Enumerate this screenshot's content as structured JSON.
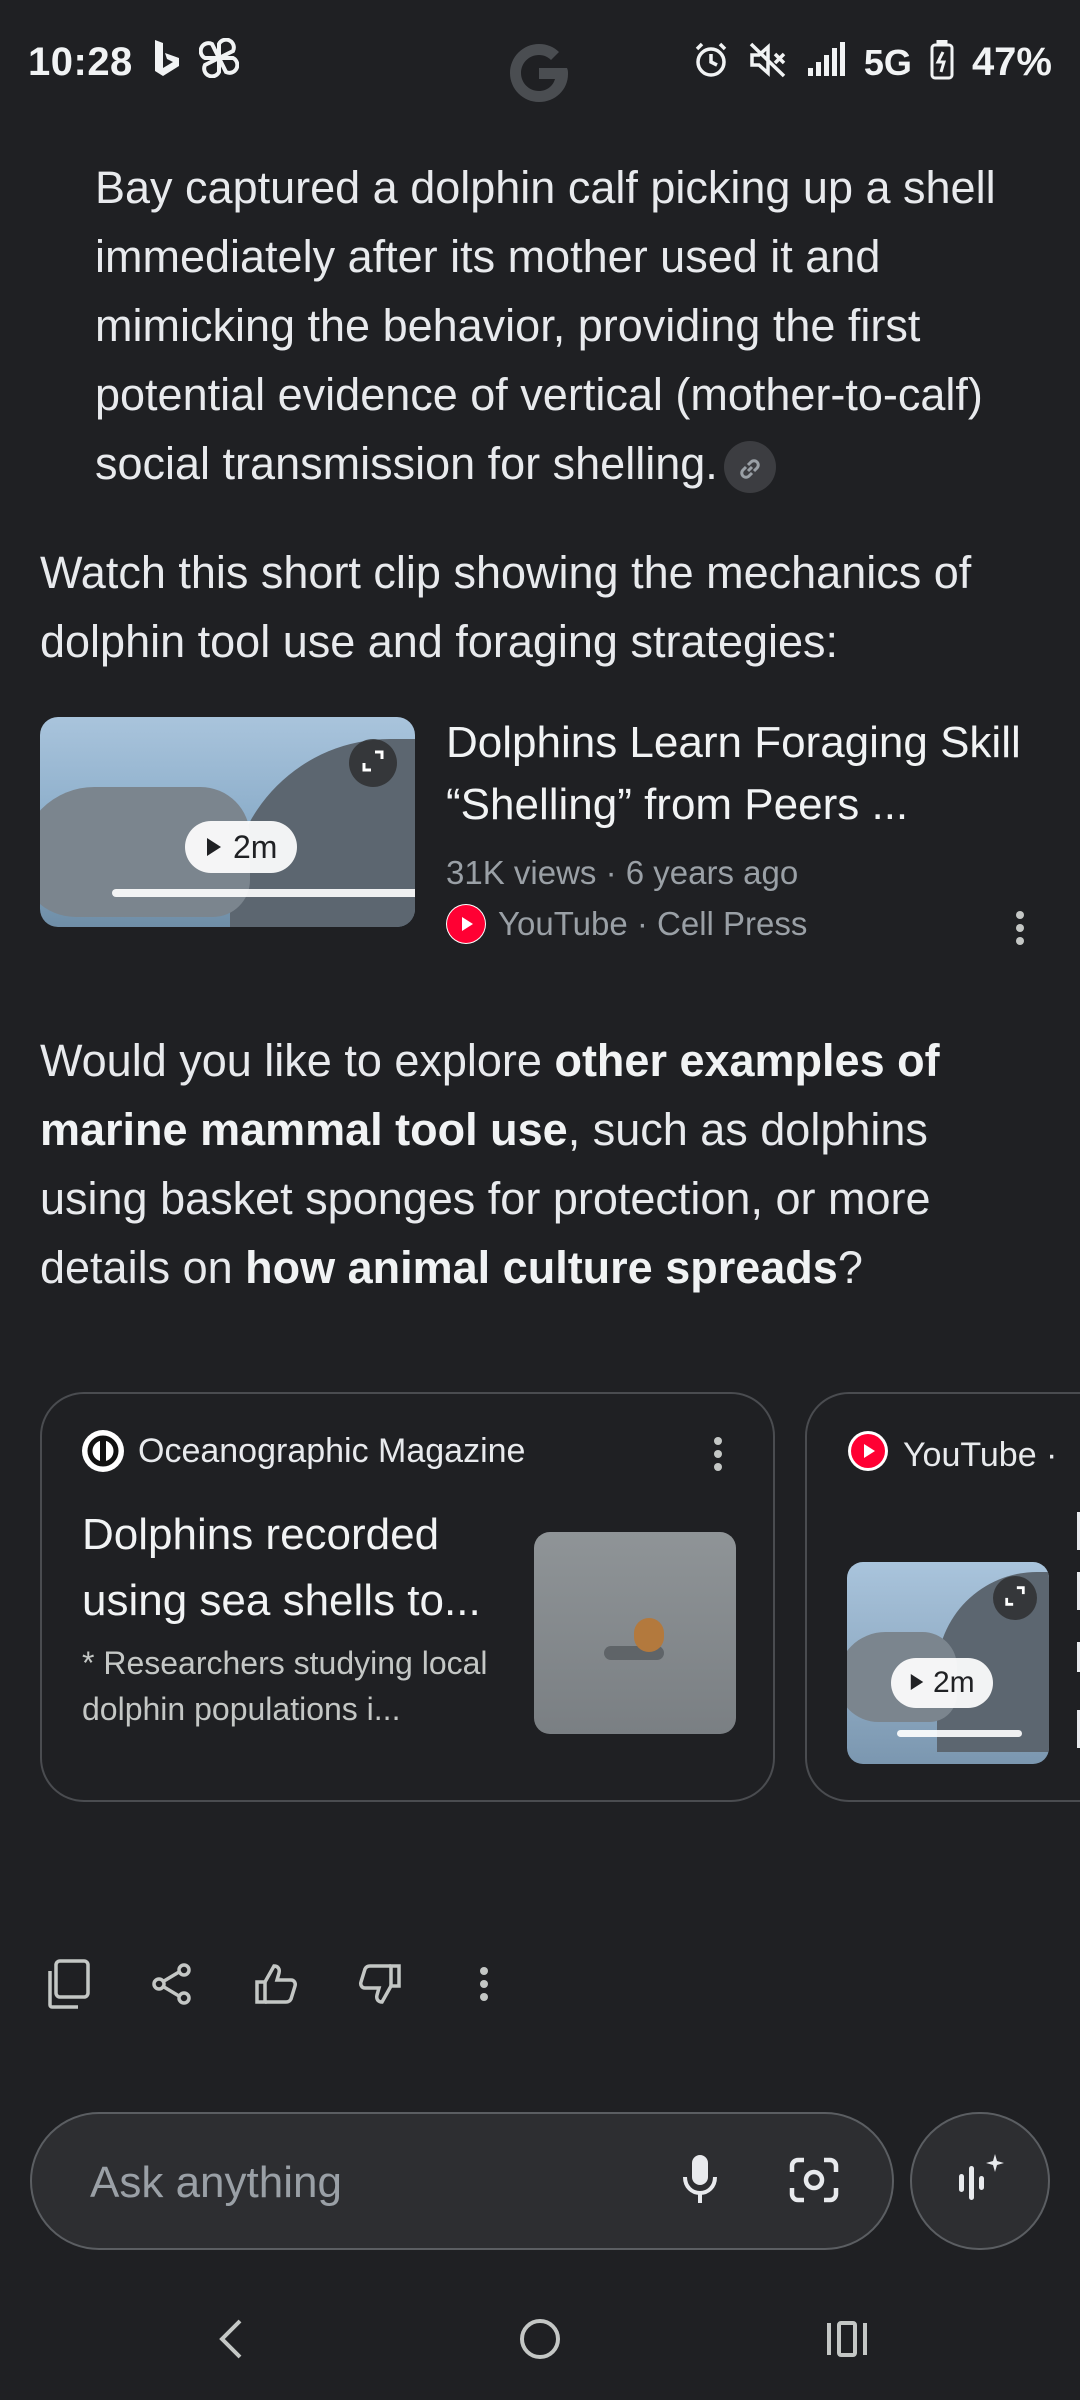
{
  "status_bar": {
    "time": "10:28",
    "network": "5G",
    "battery": "47%"
  },
  "content": {
    "paragraph_1": "Bay captured a dolphin calf picking up a shell immediately after its mother used it and mimicking the behavior, providing the first potential evidence of vertical (mother-to-calf) social transmission for shelling.",
    "intro": "Watch this short clip showing the mechanics of dolphin tool use and foraging strategies:",
    "video": {
      "title": "Dolphins Learn Foraging Skill “Shelling” from Peers ...",
      "meta": "31K views · 6 years ago",
      "source": "YouTube · Cell Press",
      "duration": "2m"
    },
    "question": {
      "part1": "Would you like to explore ",
      "bold1": "other examples of marine mammal tool use",
      "part2": ", such as dolphins using basket sponges for protection, or more details on ",
      "bold2": "how animal culture spreads",
      "part3": "?"
    }
  },
  "cards": [
    {
      "source": "Oceanographic Magazine",
      "title": "Dolphins recorded using sea shells to...",
      "snippet": "* Researchers studying local dolphin populations i..."
    },
    {
      "source": "YouTube ·",
      "duration": "2m"
    }
  ],
  "input": {
    "placeholder": "Ask anything"
  },
  "icons": {
    "status": [
      "bing-icon",
      "pinwheel-icon",
      "alarm-icon",
      "mute-icon",
      "signal-icon",
      "battery-icon"
    ],
    "actions": [
      "copy-icon",
      "share-icon",
      "thumbs-up-icon",
      "thumbs-down-icon",
      "more-vert-icon"
    ]
  }
}
